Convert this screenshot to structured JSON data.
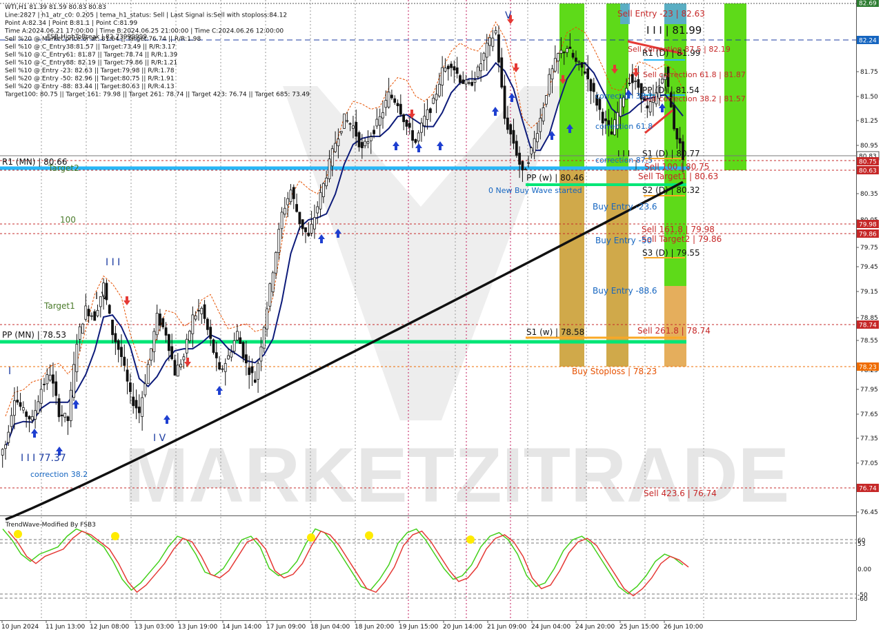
{
  "header": {
    "lines": [
      "WTI,H1  81.39 81.59 80.83 80.83",
      "Line:2827 | h1_atr_c0: 0.205 | tema_h1_status: Sell | Last Signal is:Sell with stoploss:84.12",
      "Point A:82.34 | Point B:81.1 | Point C:81.99",
      "Time A:2024.06.21 17:00:00 | Time B:2024.06.25 21:00:00 | Time C:2024.06.26 12:00:00",
      "Sell %20 @ Market price or at: 81.64 || Target:76.74 || R/R:1.98",
      "Sell %10 @ C_Entry38:81.57 || Target:73.49 || R/R:3.17",
      "Sell %10 @ C_Entry61: 81.87 || Target:78.74 || R/R:1.39",
      "Sell %10 @ C_Entry88: 82.19 || Target:79.86 || R/R:1.21",
      "Sell %10 @ Entry -23: 82.63 || Target:79.98 || R/R:1.78",
      "Sell %20 @ Entry -50: 82.96 || Target:80.75 || R/R:1.91",
      "Sell %20 @ Entry -88: 83.44 || Target:80.63 || R/R:4.13",
      "Target100: 80.75 || Target 161: 79.98 || Target 261: 78.74 || Target 423: 76.74 || Target 685: 73.49"
    ],
    "fsb_label": "FSB-HighToBreak | 82.73999999"
  },
  "watermark": "MARKETZITRADE",
  "price_axis": {
    "ticks": [
      "82.70",
      "82.45",
      "82.20",
      "81.95",
      "81.70",
      "81.45",
      "81.20",
      "80.95",
      "80.70",
      "80.45",
      "80.20",
      "79.95",
      "79.70",
      "79.45",
      "79.20",
      "78.95",
      "78.70",
      "78.45",
      "78.20",
      "77.95",
      "77.70",
      "77.45",
      "77.20",
      "76.95",
      "76.70",
      "76.45"
    ],
    "tick_labels": [
      "81.75",
      "81.50",
      "81.25",
      "80.95",
      "80.35",
      "80.05",
      "79.75",
      "79.45",
      "79.15",
      "78.85",
      "78.55",
      "78.25",
      "77.95",
      "77.65",
      "77.35",
      "77.05",
      "76.45"
    ],
    "badges": [
      {
        "text": "82.69",
        "color": "#2e7d32"
      },
      {
        "text": "82.24",
        "color": "#1565c0"
      },
      {
        "text": "80.83",
        "color": "#ffffff"
      },
      {
        "text": "80.75",
        "color": "#c62828"
      },
      {
        "text": "80.63",
        "color": "#c62828"
      },
      {
        "text": "79.98",
        "color": "#c62828"
      },
      {
        "text": "79.86",
        "color": "#c62828"
      },
      {
        "text": "78.74",
        "color": "#c62828"
      },
      {
        "text": "78.23",
        "color": "#ef6c00"
      },
      {
        "text": "76.74",
        "color": "#c62828"
      }
    ]
  },
  "time_axis": {
    "labels": [
      "10 Jun 2024",
      "11 Jun 13:00",
      "12 Jun 08:00",
      "13 Jun 03:00",
      "13 Jun 19:00",
      "14 Jun 14:00",
      "17 Jun 09:00",
      "18 Jun 04:00",
      "18 Jun 20:00",
      "19 Jun 15:00",
      "20 Jun 14:00",
      "21 Jun 09:00",
      "24 Jun 04:00",
      "24 Jun 20:00",
      "25 Jun 15:00",
      "26 Jun 10:00"
    ]
  },
  "chart_labels": {
    "r1_mn": "R1 (MN) | 80.66",
    "pp_mn": "PP (MN) | 78.53",
    "pp_w": "PP (w) | 80.46",
    "s1_w": "S1 (w) | 78.58",
    "r1_d": "R1 (D) | 81.99",
    "pp_d": "PP (D) | 81.54",
    "s1_d": "S1 (D) | 80.77",
    "s2_d": "S2 (D) | 80.32",
    "s3_d": "S3 (D) | 79.55",
    "sell_entry_23": "Sell Entry -23 | 82.63",
    "sell_correction_875": "Sell correction 87.5 | 82.19",
    "sell_correction_618": "Sell correction 61.8 | 81.87",
    "sell_correction_382": "Sell correction 38.2 | 81.57",
    "sell_100": "Sell 100 | 80.75",
    "sell_target1": "Sell Target1 | 80.63",
    "sell_1618": "Sell 161.8 | 79.98",
    "sell_target2": "Sell Target2 | 79.86",
    "sell_2618": "Sell 261.8 | 78.74",
    "sell_4236": "Sell 423.6 | 76.74",
    "buy_stoploss": "Buy Stoploss | 78.23",
    "buy_entry_23": "Buy Entry -23.6",
    "buy_entry_50": "Buy Entry -50",
    "buy_entry_88": "Buy Entry -88.6",
    "new_buy_wave": "0 New Buy Wave started",
    "correction_382_top": "correction 38.2",
    "correction_618": "correction 61.8",
    "correction_875": "correction 87.5",
    "correction_382_bottom": "correction 38.2",
    "target1": "Target1",
    "target2": "Target2",
    "hundred": "100",
    "wave_iii_top": "I I I | 81.99",
    "wave_iii_bottom": "I I I 77.37",
    "wave_iii_mid": "I I I",
    "wave_iv": "I V",
    "wave_iv_top": "I V",
    "wave_v": "V",
    "wave_i": "I",
    "wave_ii_mark": "I I I"
  },
  "oscillator": {
    "title": "TrendWave-Modified By FSB3",
    "levels": [
      "60",
      "53",
      "0.00",
      "-50",
      "-60"
    ]
  },
  "chart_data": {
    "type": "candlestick",
    "title": "WTI,H1",
    "ohlc_last": {
      "open": 81.39,
      "high": 81.59,
      "low": 80.83,
      "close": 80.83
    },
    "ylim": [
      76.3,
      82.75
    ],
    "xlabels": [
      "10 Jun 2024",
      "11 Jun 13:00",
      "12 Jun 08:00",
      "13 Jun 03:00",
      "13 Jun 19:00",
      "14 Jun 14:00",
      "17 Jun 09:00",
      "18 Jun 04:00",
      "18 Jun 20:00",
      "19 Jun 15:00",
      "20 Jun 14:00",
      "21 Jun 09:00",
      "24 Jun 04:00",
      "24 Jun 20:00",
      "25 Jun 15:00",
      "26 Jun 10:00"
    ],
    "close_path": [
      77.2,
      77.8,
      77.6,
      77.5,
      77.9,
      78.1,
      77.6,
      77.5,
      78.5,
      78.9,
      78.8,
      79.2,
      78.6,
      78.3,
      77.8,
      77.6,
      78.2,
      78.8,
      78.6,
      78.1,
      78.3,
      78.8,
      78.9,
      78.5,
      78.1,
      78.3,
      78.6,
      78.2,
      78.0,
      78.7,
      79.4,
      80.1,
      80.4,
      80.0,
      79.8,
      80.2,
      80.6,
      81.0,
      81.3,
      81.2,
      80.9,
      81.1,
      81.3,
      81.6,
      81.5,
      81.2,
      81.0,
      81.3,
      81.5,
      81.9,
      82.0,
      81.8,
      81.7,
      81.9,
      82.2,
      82.4,
      81.3,
      81.0,
      80.6,
      80.9,
      81.3,
      81.8,
      82.1,
      82.2,
      82.0,
      81.9,
      81.6,
      81.3,
      81.1,
      81.5,
      81.8,
      81.7,
      81.4,
      81.6,
      81.9,
      81.2,
      80.83
    ],
    "ema_ratio_levels": [
      {
        "name": "R1 (MN)",
        "value": 80.66
      },
      {
        "name": "PP (MN)",
        "value": 78.53
      },
      {
        "name": "PP (w)",
        "value": 80.46
      },
      {
        "name": "S1 (w)",
        "value": 78.58
      },
      {
        "name": "R1 (D)",
        "value": 81.99
      },
      {
        "name": "PP (D)",
        "value": 81.54
      },
      {
        "name": "S1 (D)",
        "value": 80.77
      },
      {
        "name": "S2 (D)",
        "value": 80.32
      },
      {
        "name": "S3 (D)",
        "value": 79.55
      },
      {
        "name": "Sell 100",
        "value": 80.75
      },
      {
        "name": "Sell Target1",
        "value": 80.63
      },
      {
        "name": "Sell 161.8",
        "value": 79.98
      },
      {
        "name": "Sell Target2",
        "value": 79.86
      },
      {
        "name": "Sell 261.8",
        "value": 78.74
      },
      {
        "name": "Sell 423.6",
        "value": 76.74
      },
      {
        "name": "Buy Stoploss",
        "value": 78.23
      }
    ],
    "oscillator_ylim": [
      -70,
      70
    ],
    "oscillator_values": [
      55,
      40,
      20,
      10,
      20,
      25,
      30,
      45,
      55,
      50,
      40,
      30,
      10,
      -15,
      -30,
      -20,
      -5,
      10,
      30,
      45,
      40,
      20,
      -5,
      -10,
      0,
      20,
      40,
      45,
      30,
      0,
      -10,
      -5,
      10,
      35,
      55,
      50,
      35,
      15,
      -5,
      -25,
      -30,
      -15,
      5,
      35,
      50,
      55,
      40,
      20,
      0,
      -15,
      -10,
      5,
      30,
      45,
      50,
      40,
      20,
      -10,
      -25,
      -20,
      0,
      25,
      40,
      45,
      35,
      15,
      -5,
      -25,
      -35,
      -25,
      -10,
      10,
      20,
      15,
      5
    ]
  }
}
